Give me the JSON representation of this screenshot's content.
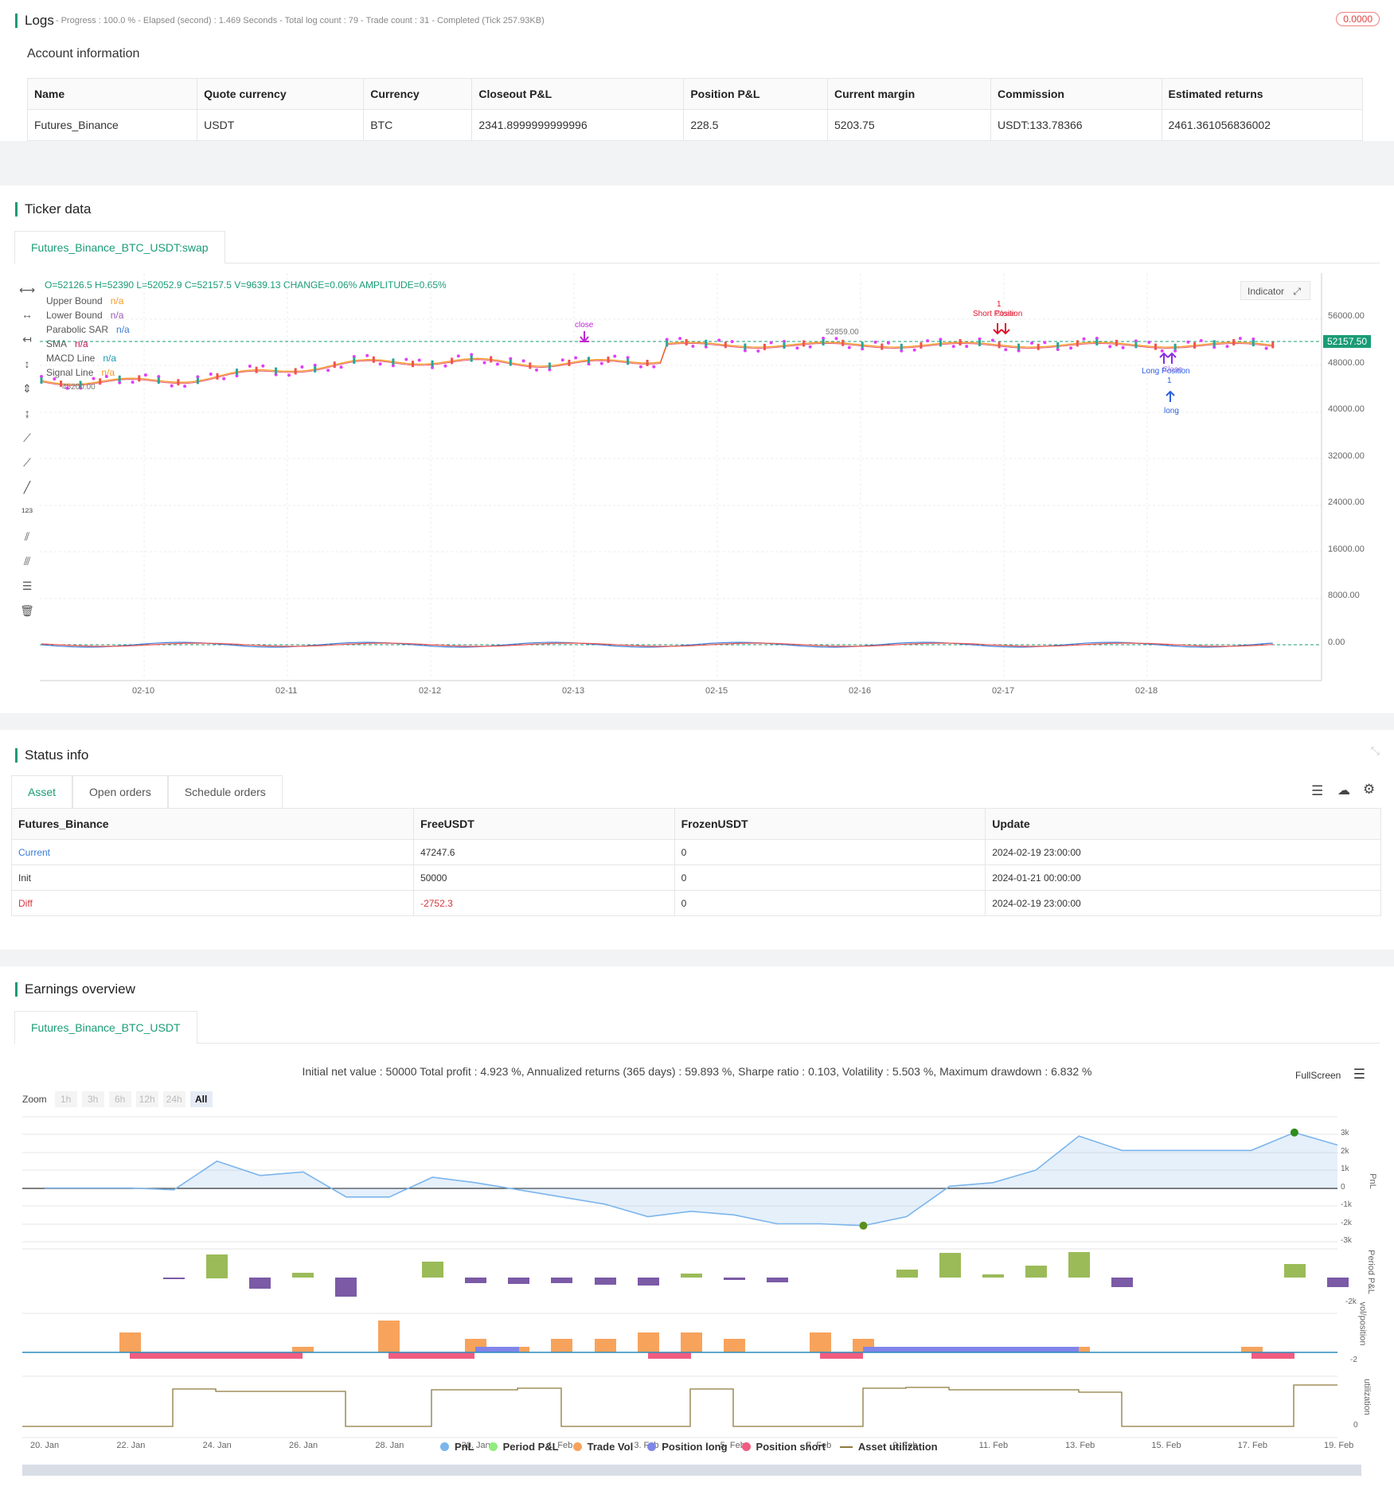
{
  "logs": {
    "title": "Logs",
    "status": "- Progress : 100.0 % - Elapsed (second) : 1.469  Seconds - Total log count : 79 - Trade count : 31 - Completed (Tick 257.93KB)",
    "badge": "0.0000",
    "account_title": "Account information",
    "headers": [
      "Name",
      "Quote currency",
      "Currency",
      "Closeout P&L",
      "Position P&L",
      "Current margin",
      "Commission",
      "Estimated returns"
    ],
    "row": [
      "Futures_Binance",
      "USDT",
      "BTC",
      "2341.8999999999996",
      "228.5",
      "5203.75",
      "USDT:133.78366",
      "2461.361056836002"
    ]
  },
  "ticker": {
    "title": "Ticker data",
    "tab": "Futures_Binance_BTC_USDT:swap",
    "ohlc": "O=52126.5 H=52390 L=52052.9 C=52157.5 V=9639.13 CHANGE=0.06% AMPLITUDE=0.65%",
    "legend": [
      {
        "name": "Upper Bound",
        "value": "n/a",
        "color": "#f59a23"
      },
      {
        "name": "Lower Bound",
        "value": "n/a",
        "color": "#9b59b6"
      },
      {
        "name": "Parabolic SAR",
        "value": "n/a",
        "color": "#3a7bd5"
      },
      {
        "name": "SMA",
        "value": "n/a",
        "color": "#c2185b"
      },
      {
        "name": "MACD Line",
        "value": "n/a",
        "color": "#1a9cb0"
      },
      {
        "name": "Signal Line",
        "value": "n/a",
        "color": "#f59a23"
      }
    ],
    "indicator_btn": "Indicator",
    "y_ticks": [
      "56000.00",
      "48000.00",
      "40000.00",
      "32000.00",
      "24000.00",
      "16000.00",
      "8000.00",
      "0.00"
    ],
    "x_ticks": [
      "02-10",
      "02-11",
      "02-12",
      "02-13",
      "02-15",
      "02-16",
      "02-17",
      "02-18"
    ],
    "current_price": "52157.50",
    "low_mark": "45200.00",
    "high_mark": "52859.00",
    "annotations": {
      "close_top": "close",
      "short_num": "1",
      "short_label": "Short Position",
      "short_close": "Close",
      "long_label": "Long Position",
      "long_close": "Close",
      "long_num": "1",
      "long_bottom": "long"
    }
  },
  "status": {
    "title": "Status info",
    "tabs": [
      "Asset",
      "Open orders",
      "Schedule orders"
    ],
    "headers": [
      "Futures_Binance",
      "FreeUSDT",
      "FrozenUSDT",
      "Update"
    ],
    "rows": [
      {
        "label": "Current",
        "free": "47247.6",
        "frozen": "0",
        "update": "2024-02-19 23:00:00"
      },
      {
        "label": "Init",
        "free": "50000",
        "frozen": "0",
        "update": "2024-01-21 00:00:00"
      },
      {
        "label": "Diff",
        "free": "-2752.3",
        "frozen": "0",
        "update": "2024-02-19 23:00:00"
      }
    ]
  },
  "earnings": {
    "title": "Earnings overview",
    "tab": "Futures_Binance_BTC_USDT",
    "summary": "Initial net value : 50000 Total profit : 4.923 %, Annualized returns (365 days) : 59.893 %, Sharpe ratio : 0.103, Volatility : 5.503 %, Maximum drawdown : 6.832 %",
    "fullscreen": "FullScreen",
    "zoom_label": "Zoom",
    "zoom_options": [
      "1h",
      "3h",
      "6h",
      "12h",
      "24h",
      "All"
    ],
    "pnl_ticks": [
      "3k",
      "2k",
      "1k",
      "0",
      "-1k",
      "-2k",
      "-3k"
    ],
    "pnl_axis": "PnL",
    "period_axis": "Period P&L",
    "period_tick": "-2k",
    "vol_axis": "vol/position",
    "vol_tick": "-2",
    "util_axis": "utilization",
    "util_tick": "0",
    "x_ticks": [
      "20. Jan",
      "22. Jan",
      "24. Jan",
      "26. Jan",
      "28. Jan",
      "30. Jan",
      "1. Feb",
      "3. Feb",
      "5. Feb",
      "7. Feb",
      "9. Feb",
      "11. Feb",
      "13. Feb",
      "15. Feb",
      "17. Feb",
      "19. Feb"
    ],
    "legend": [
      {
        "name": "PnL",
        "color": "#7cb5ec"
      },
      {
        "name": "Period P&L",
        "color": "#90ed7d"
      },
      {
        "name": "Trade Vol",
        "color": "#f7a35c"
      },
      {
        "name": "Position long",
        "color": "#8085e9"
      },
      {
        "name": "Position short",
        "color": "#f15c80"
      },
      {
        "name": "Asset utilization",
        "color": "#8d7a3c"
      }
    ]
  },
  "chart_data": {
    "type": "line",
    "x": [
      "20. Jan",
      "21. Jan",
      "22. Jan",
      "23. Jan",
      "24. Jan",
      "25. Jan",
      "26. Jan",
      "27. Jan",
      "28. Jan",
      "29. Jan",
      "30. Jan",
      "31. Jan",
      "1. Feb",
      "2. Feb",
      "3. Feb",
      "4. Feb",
      "5. Feb",
      "6. Feb",
      "7. Feb",
      "8. Feb",
      "9. Feb",
      "10. Feb",
      "11. Feb",
      "12. Feb",
      "13. Feb",
      "14. Feb",
      "15. Feb",
      "16. Feb",
      "17. Feb",
      "18. Feb",
      "19. Feb"
    ],
    "series": [
      {
        "name": "PnL",
        "values": [
          0,
          0,
          0,
          -100,
          1500,
          700,
          900,
          -500,
          -500,
          600,
          300,
          -100,
          -500,
          -900,
          -1600,
          -1300,
          -1500,
          -2000,
          -2000,
          -2100,
          -1600,
          100,
          300,
          1000,
          2900,
          2100,
          2100,
          2100,
          2100,
          3100,
          2400
        ]
      }
    ],
    "ylim": [
      -3000,
      3000
    ]
  }
}
